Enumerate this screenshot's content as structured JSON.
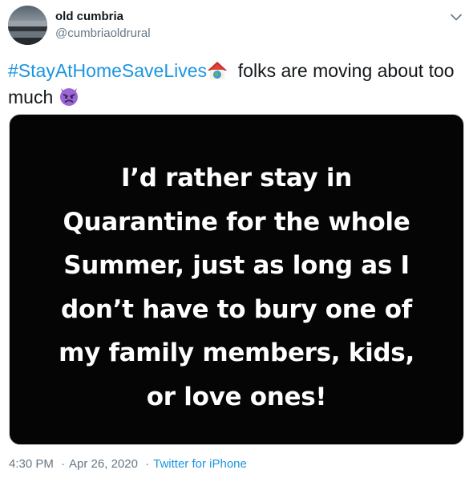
{
  "author": {
    "display_name": "old cumbria",
    "handle": "@cumbriaoldrural"
  },
  "tweet": {
    "hashtag": "#StayAtHomeSaveLives",
    "text_after_hashtag": "folks are moving about too",
    "text_line2": "much",
    "emojis": [
      "house-with-globe-emoji",
      "angry-devil-emoji"
    ]
  },
  "media": {
    "lines": [
      "I’d rather stay in",
      "Quarantine for the whole",
      "Summer, just as long as I",
      "don’t have to bury one of",
      "my family members, kids,",
      "or love ones!"
    ]
  },
  "meta": {
    "time": "4:30 PM",
    "dot1": "·",
    "date": "Apr 26, 2020",
    "dot2": "·",
    "source": "Twitter for iPhone"
  },
  "colors": {
    "link": "#1b95e0",
    "secondary_text": "#657786",
    "primary_text": "#14171a",
    "media_background": "#050505"
  }
}
